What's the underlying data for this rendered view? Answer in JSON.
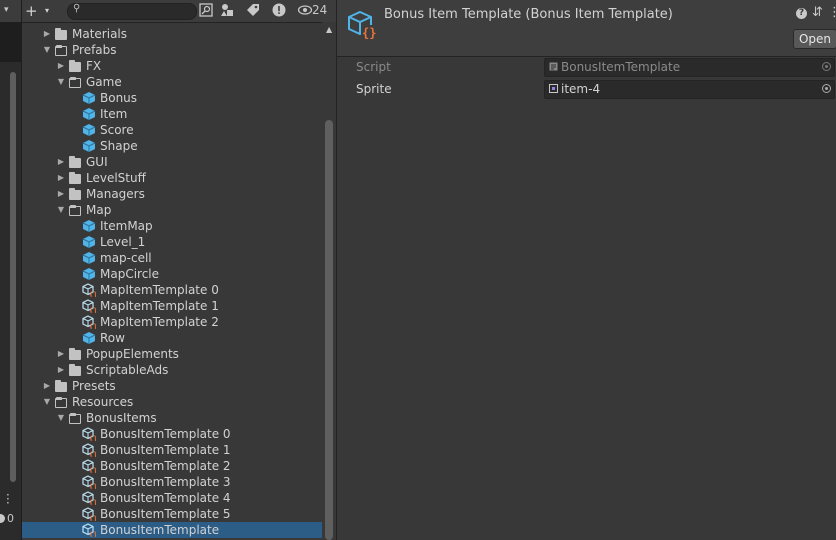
{
  "toolbar": {
    "add_label": "+",
    "add_caret": "▾",
    "search_value": "",
    "hidden_count": "24"
  },
  "left_strip": {
    "counter": "0"
  },
  "tree": [
    {
      "label": "Materials",
      "depth": 2,
      "kind": "folder",
      "expanded": false
    },
    {
      "label": "Prefabs",
      "depth": 2,
      "kind": "folder",
      "expanded": true
    },
    {
      "label": "FX",
      "depth": 3,
      "kind": "folder",
      "expanded": false
    },
    {
      "label": "Game",
      "depth": 3,
      "kind": "folder",
      "expanded": true
    },
    {
      "label": "Bonus",
      "depth": 4,
      "kind": "prefab"
    },
    {
      "label": "Item",
      "depth": 4,
      "kind": "prefab"
    },
    {
      "label": "Score",
      "depth": 4,
      "kind": "prefab"
    },
    {
      "label": "Shape",
      "depth": 4,
      "kind": "prefab"
    },
    {
      "label": "GUI",
      "depth": 3,
      "kind": "folder",
      "expanded": false
    },
    {
      "label": "LevelStuff",
      "depth": 3,
      "kind": "folder",
      "expanded": false
    },
    {
      "label": "Managers",
      "depth": 3,
      "kind": "folder",
      "expanded": false
    },
    {
      "label": "Map",
      "depth": 3,
      "kind": "folder",
      "expanded": true
    },
    {
      "label": "ItemMap",
      "depth": 4,
      "kind": "prefab"
    },
    {
      "label": "Level_1",
      "depth": 4,
      "kind": "prefab"
    },
    {
      "label": "map-cell",
      "depth": 4,
      "kind": "prefab"
    },
    {
      "label": "MapCircle",
      "depth": 4,
      "kind": "prefab"
    },
    {
      "label": "MapItemTemplate 0",
      "depth": 4,
      "kind": "scriptable"
    },
    {
      "label": "MapItemTemplate 1",
      "depth": 4,
      "kind": "scriptable"
    },
    {
      "label": "MapItemTemplate 2",
      "depth": 4,
      "kind": "scriptable"
    },
    {
      "label": "Row",
      "depth": 4,
      "kind": "prefab"
    },
    {
      "label": "PopupElements",
      "depth": 3,
      "kind": "folder",
      "expanded": false
    },
    {
      "label": "ScriptableAds",
      "depth": 3,
      "kind": "folder",
      "expanded": false
    },
    {
      "label": "Presets",
      "depth": 2,
      "kind": "folder",
      "expanded": false
    },
    {
      "label": "Resources",
      "depth": 2,
      "kind": "folder",
      "expanded": true
    },
    {
      "label": "BonusItems",
      "depth": 3,
      "kind": "folder",
      "expanded": true
    },
    {
      "label": "BonusItemTemplate 0",
      "depth": 4,
      "kind": "scriptable"
    },
    {
      "label": "BonusItemTemplate 1",
      "depth": 4,
      "kind": "scriptable"
    },
    {
      "label": "BonusItemTemplate 2",
      "depth": 4,
      "kind": "scriptable"
    },
    {
      "label": "BonusItemTemplate 3",
      "depth": 4,
      "kind": "scriptable"
    },
    {
      "label": "BonusItemTemplate 4",
      "depth": 4,
      "kind": "scriptable"
    },
    {
      "label": "BonusItemTemplate 5",
      "depth": 4,
      "kind": "scriptable"
    },
    {
      "label": "BonusItemTemplate",
      "depth": 4,
      "kind": "scriptable",
      "selected": true
    }
  ],
  "inspector": {
    "title": "Bonus Item Template (Bonus Item Template)",
    "open_label": "Open",
    "properties": [
      {
        "label": "Script",
        "value": "BonusItemTemplate",
        "disabled": true,
        "icon": "script-icon"
      },
      {
        "label": "Sprite",
        "value": "item-4",
        "disabled": false,
        "icon": "sprite-icon"
      }
    ]
  },
  "colors": {
    "panel_bg": "#383838",
    "selection": "#2c5d87",
    "prefab_blue": "#4fb4e8",
    "scriptable_orange": "#e8743b"
  }
}
